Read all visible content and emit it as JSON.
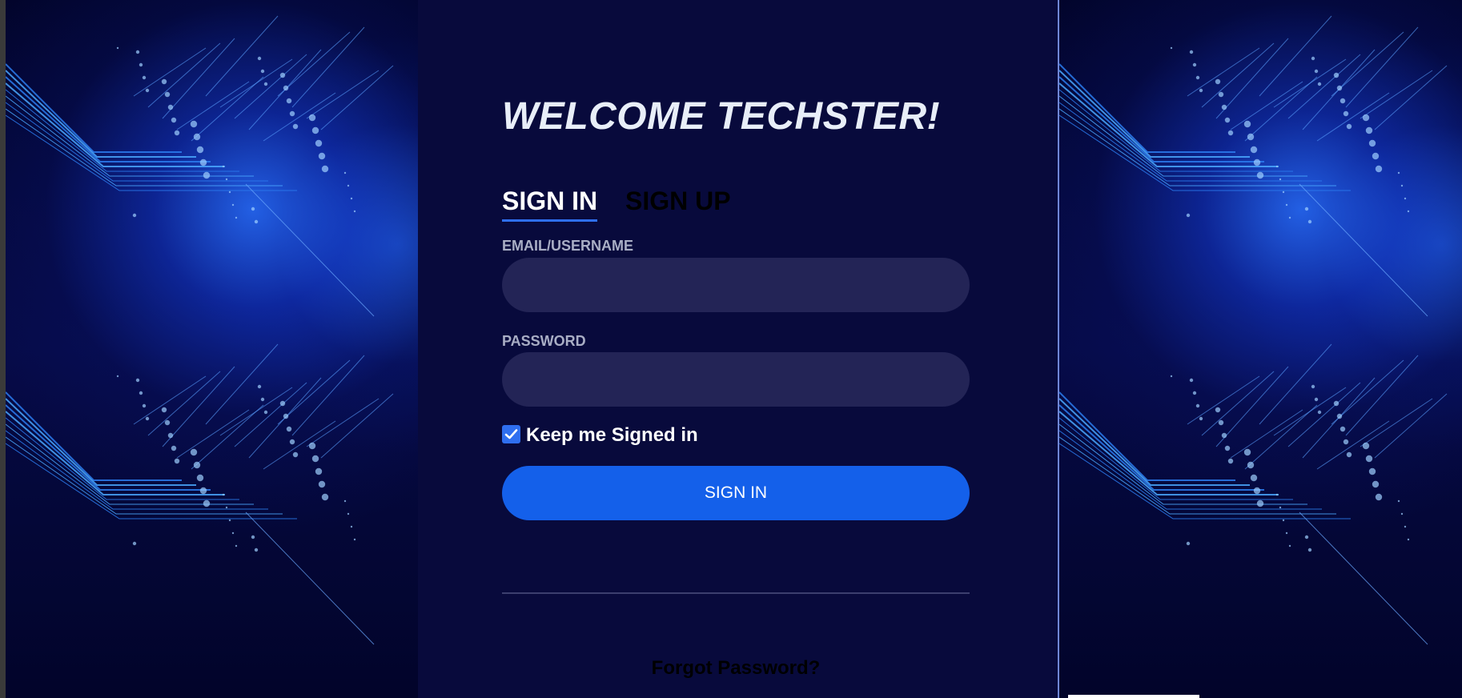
{
  "page": {
    "heading": "WELCOME TECHSTER!"
  },
  "tabs": [
    {
      "label": "SIGN IN",
      "active": true
    },
    {
      "label": "SIGN UP",
      "active": false
    }
  ],
  "form": {
    "email_label": "EMAIL/USERNAME",
    "email_value": "",
    "password_label": "PASSWORD",
    "password_value": "",
    "remember_label": "Keep me Signed in",
    "remember_checked": true,
    "submit_label": "SIGN IN",
    "forgot_label": "Forgot Password?"
  },
  "colors": {
    "panel_bg": "#080a3c",
    "input_bg": "#232456",
    "accent": "#1460ea",
    "tab_underline": "#2f6ff0"
  },
  "icons": [
    "checkmark-icon",
    "circuit-board-background"
  ]
}
